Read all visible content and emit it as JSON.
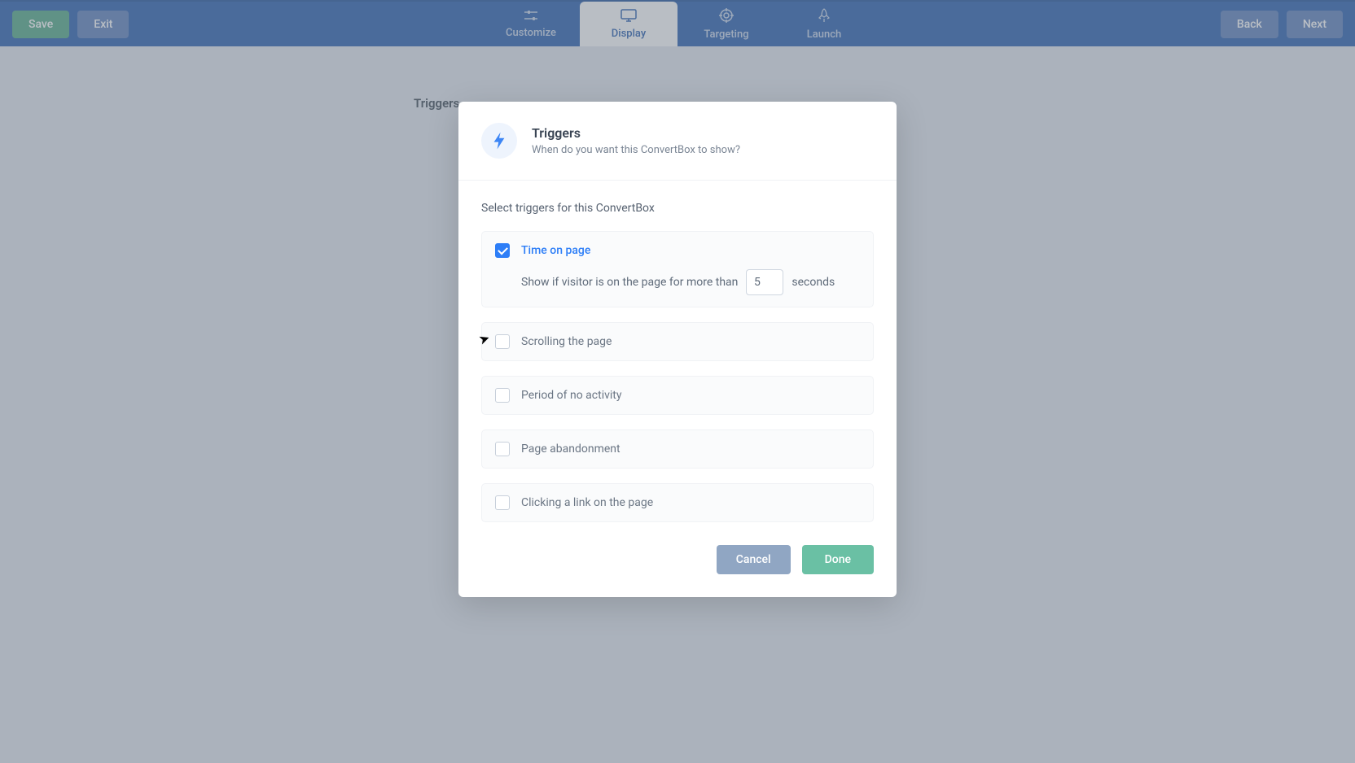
{
  "topbar": {
    "save": "Save",
    "exit": "Exit",
    "back": "Back",
    "next": "Next",
    "tabs": {
      "customize": "Customize",
      "display": "Display",
      "targeting": "Targeting",
      "launch": "Launch"
    }
  },
  "background": {
    "title": "Triggers"
  },
  "modal": {
    "title": "Triggers",
    "subtitle": "When do you want this ConvertBox to show?",
    "sectionLabel": "Select triggers for this ConvertBox",
    "triggers": {
      "timeOnPage": {
        "label": "Time on page",
        "prefix": "Show if visitor is on the page for more than",
        "value": "5",
        "suffix": "seconds"
      },
      "scrolling": {
        "label": "Scrolling the page"
      },
      "noActivity": {
        "label": "Period of no activity"
      },
      "abandonment": {
        "label": "Page abandonment"
      },
      "clickLink": {
        "label": "Clicking a link on the page"
      }
    },
    "footer": {
      "cancel": "Cancel",
      "done": "Done"
    }
  }
}
